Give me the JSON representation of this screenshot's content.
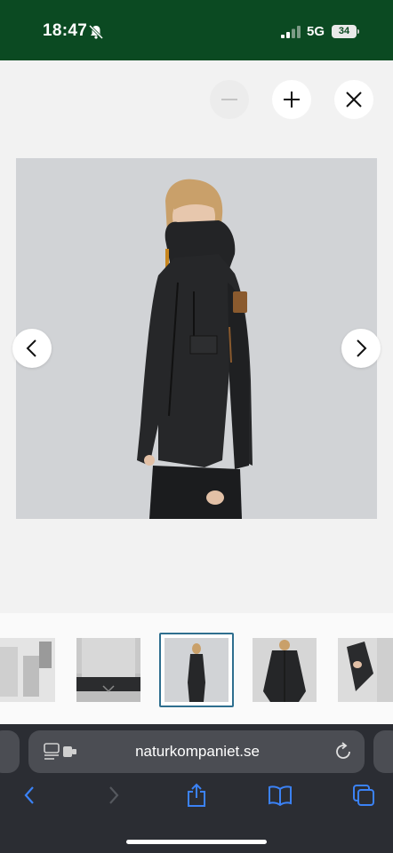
{
  "status_bar": {
    "time": "18:47",
    "network": "5G",
    "battery": "34",
    "background_color": "#0b4a22"
  },
  "viewer_controls": {
    "zoom_out_icon": "minus-icon",
    "zoom_in_icon": "plus-icon",
    "close_icon": "close-icon"
  },
  "gallery": {
    "prev_icon": "chevron-left-icon",
    "next_icon": "chevron-right-icon",
    "thumbnail_count_visible": 5,
    "selected_thumbnail": 3,
    "selected_border_color": "#2f6f8f"
  },
  "browser": {
    "url": "naturkompaniet.se",
    "accent_color": "#3b82f6",
    "toolbar_icons": [
      "back-icon",
      "forward-icon",
      "share-icon",
      "bookmarks-icon",
      "tabs-icon"
    ]
  }
}
